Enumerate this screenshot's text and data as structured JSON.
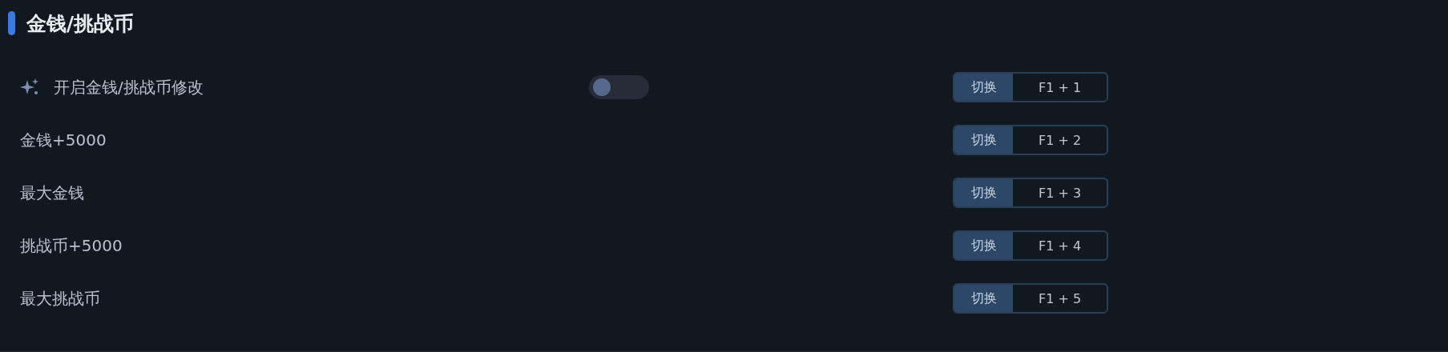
{
  "section": {
    "title": "金钱/挑战币"
  },
  "options": [
    {
      "kind": "toggle",
      "label": "开启金钱/挑战币修改",
      "on": false,
      "hotkey_action": "切换",
      "hotkey": "F1 + 1"
    },
    {
      "kind": "action",
      "label": "金钱+5000",
      "hotkey_action": "切换",
      "hotkey": "F1 + 2"
    },
    {
      "kind": "action",
      "label": "最大金钱",
      "hotkey_action": "切换",
      "hotkey": "F1 + 3"
    },
    {
      "kind": "action",
      "label": "挑战币+5000",
      "hotkey_action": "切换",
      "hotkey": "F1 + 4"
    },
    {
      "kind": "action",
      "label": "最大挑战币",
      "hotkey_action": "切换",
      "hotkey": "F1 + 5"
    }
  ]
}
